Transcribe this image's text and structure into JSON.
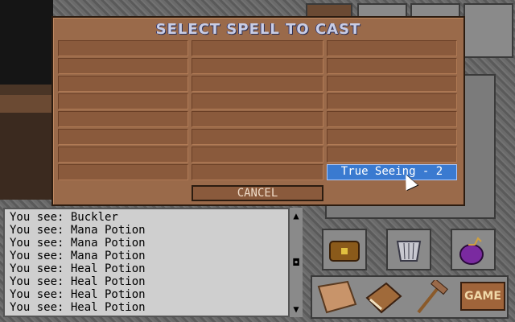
{
  "dialog": {
    "title": "SELECT SPELL TO CAST",
    "cancel_label": "CANCEL",
    "spells": [
      "True Seeing - 2"
    ]
  },
  "message_log": {
    "lines": [
      "You see: Buckler",
      "You see: Mana Potion",
      "You see: Mana Potion",
      "You see: Mana Potion",
      "You see: Heal Potion",
      "You see: Heal Potion",
      "You see: Heal Potion",
      "You see: Heal Potion"
    ]
  },
  "toolbar": {
    "game_label": "GAME",
    "icons": [
      "chest-icon",
      "basket-icon",
      "bag-icon",
      "map-icon",
      "journal-icon",
      "hammer-icon"
    ]
  },
  "colors": {
    "dialog_bg": "#9a6a4a",
    "selected_spell": "#3a7ad0",
    "title_text": "#c8cde6"
  }
}
